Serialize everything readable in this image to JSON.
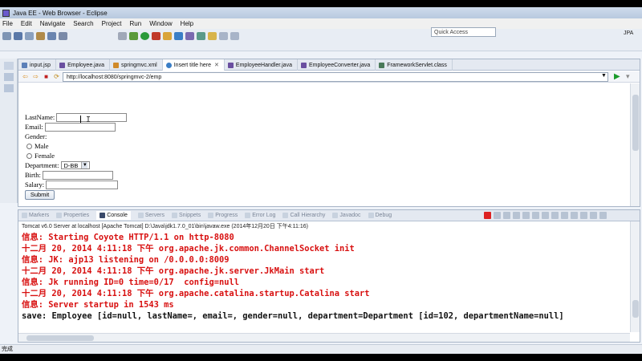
{
  "window": {
    "title": "Java EE - Web Browser - Eclipse"
  },
  "menu": [
    "File",
    "Edit",
    "Navigate",
    "Search",
    "Project",
    "Run",
    "Window",
    "Help"
  ],
  "quick_access": "Quick Access",
  "perspective": "JPA",
  "editor_tabs": [
    {
      "label": "input.jsp",
      "color": "#5b7fb8"
    },
    {
      "label": "Employee.java",
      "color": "#6a4fa0"
    },
    {
      "label": "springmvc.xml",
      "color": "#d08a2a"
    },
    {
      "label": "Insert title here",
      "color": "#3a7ec6",
      "active": true
    },
    {
      "label": "EmployeeHandler.java",
      "color": "#6a4fa0"
    },
    {
      "label": "EmployeeConverter.java",
      "color": "#6a4fa0"
    },
    {
      "label": "FrameworkServlet.class",
      "color": "#4a7a5a"
    }
  ],
  "url": "http://localhost:8080/springmvc-2/emp",
  "form": {
    "lastname_label": "LastName:",
    "email_label": "Email:",
    "gender_label": "Gender:",
    "male_label": "Male",
    "female_label": "Female",
    "department_label": "Department:",
    "department_value": "D-BB",
    "birth_label": "Birth:",
    "salary_label": "Salary:",
    "submit_label": "Submit"
  },
  "console_tabs": [
    "Markers",
    "Properties",
    "Console",
    "Servers",
    "Snippets",
    "Progress",
    "Error Log",
    "Call Hierarchy",
    "Javadoc",
    "Debug"
  ],
  "server_line": "Tomcat v6.0 Server at localhost [Apache Tomcat] D:\\Java\\jdk1.7.0_01\\bin\\javaw.exe (2014年12月20日 下午4:11:16)",
  "log_lines": [
    {
      "text": "信息: Starting Coyote HTTP/1.1 on http-8080",
      "kind": "err"
    },
    {
      "text": "十二月 20, 2014 4:11:18 下午 org.apache.jk.common.ChannelSocket init",
      "kind": "err"
    },
    {
      "text": "信息: JK: ajp13 listening on /0.0.0.0:8009",
      "kind": "err"
    },
    {
      "text": "十二月 20, 2014 4:11:18 下午 org.apache.jk.server.JkMain start",
      "kind": "err"
    },
    {
      "text": "信息: Jk running ID=0 time=0/17  config=null",
      "kind": "err"
    },
    {
      "text": "十二月 20, 2014 4:11:18 下午 org.apache.catalina.startup.Catalina start",
      "kind": "err"
    },
    {
      "text": "信息: Server startup in 1543 ms",
      "kind": "err"
    },
    {
      "text": "save: Employee [id=null, lastName=, email=, gender=null, department=Department [id=102, departmentName=null]",
      "kind": "out"
    }
  ],
  "status": "完成"
}
